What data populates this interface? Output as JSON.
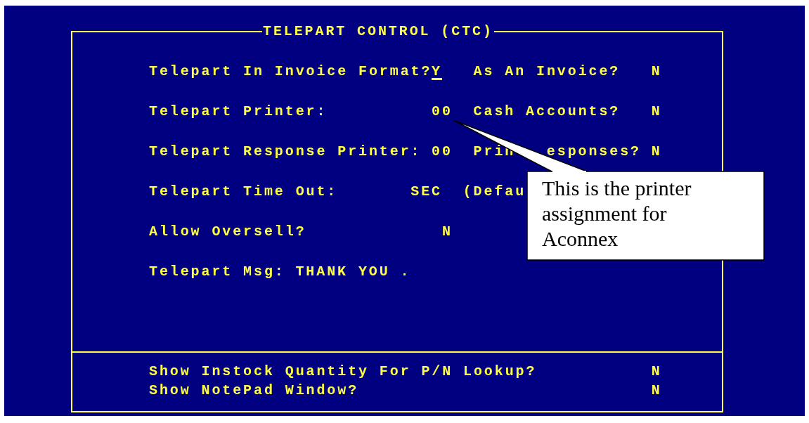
{
  "window": {
    "title": "TELEPART CONTROL (CTC)"
  },
  "rows": [
    {
      "label": "Telepart In Invoice Format?",
      "value": "Y",
      "focused": true,
      "option_label": [
        "As An Invoice?"
      ],
      "option_value": "N"
    },
    {
      "label": "Telepart Printer:",
      "value": "00",
      "focused": false,
      "option_label": [
        "Cash Accounts?"
      ],
      "option_value": "N"
    },
    {
      "label": "Telepart Response Printer:",
      "value": "00",
      "focused": false,
      "option_label": [
        "Prin",
        "esponses?"
      ],
      "option_value": "N"
    },
    {
      "label": "Telepart Time Out:",
      "value": "SEC",
      "focused": false,
      "note": "(Defau"
    },
    {
      "label": "Allow Oversell?",
      "value": "N",
      "focused": false
    },
    {
      "label": "Telepart Msg:",
      "value": "THANK YOU .",
      "focused": false
    }
  ],
  "settings": [
    {
      "label": "Show Instock Quantity For P/N Lookup?",
      "value": "N"
    },
    {
      "label": "Show NotePad Window?",
      "value": "N"
    }
  ],
  "callout": {
    "text": "This is the printer assignment for Aconnex"
  }
}
